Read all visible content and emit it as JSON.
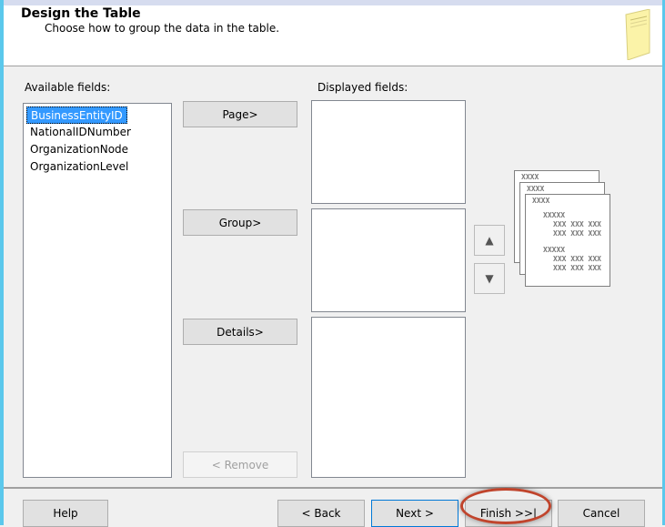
{
  "header": {
    "title": "Design the Table",
    "subtitle": "Choose how to group the data in the table."
  },
  "available": {
    "label": "Available fields:",
    "items": [
      "BusinessEntityID",
      "NationalIDNumber",
      "OrganizationNode",
      "OrganizationLevel"
    ]
  },
  "displayed": {
    "label": "Displayed fields:"
  },
  "buttons": {
    "page": "Page>",
    "group": "Group>",
    "details": "Details>",
    "remove": "< Remove"
  },
  "preview": {
    "h": "XXXX",
    "g": "XXXXX",
    "row": "XXX XXX XXX"
  },
  "footer": {
    "help": "Help",
    "back": "< Back",
    "next": "Next >",
    "finish": "Finish >>|",
    "cancel": "Cancel"
  }
}
